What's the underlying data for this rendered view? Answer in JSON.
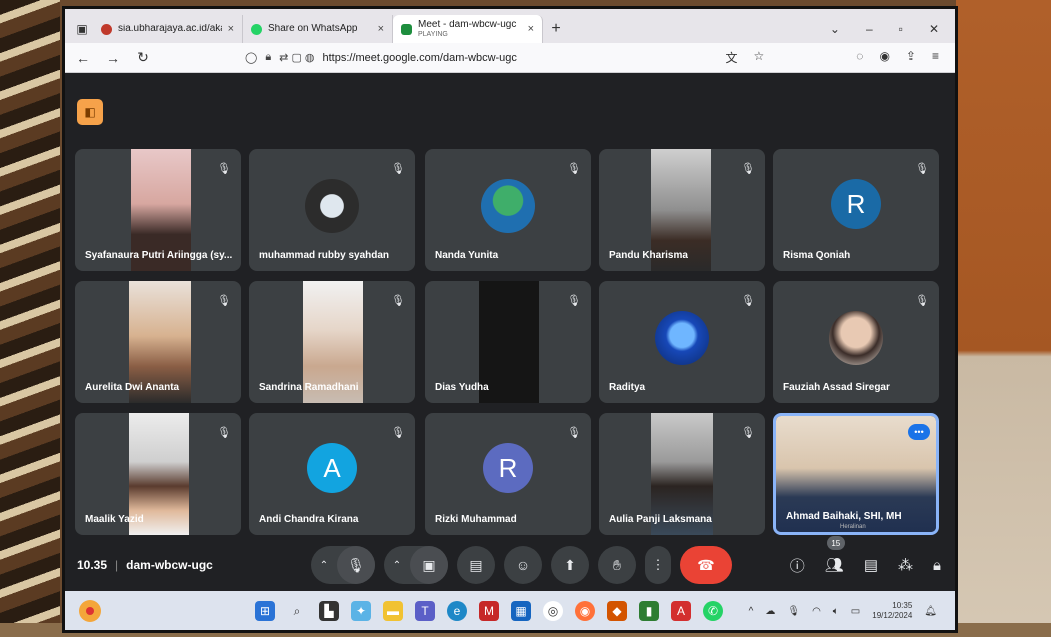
{
  "browser": {
    "tabs": [
      {
        "label": "sia.ubharajaya.ac.id/akademik/l",
        "sub": "",
        "favicon_color": "#c0392b",
        "active": false
      },
      {
        "label": "Share on WhatsApp",
        "sub": "",
        "favicon_color": "#25d366",
        "active": false
      },
      {
        "label": "Meet - dam-wbcw-ugc",
        "sub": "PLAYING",
        "favicon_color": "#1e8e3e",
        "active": true
      }
    ],
    "url": "https://meet.google.com/dam-wbcw-ugc"
  },
  "meeting": {
    "time": "10.35",
    "code": "dam-wbcw-ugc",
    "participant_count": "15",
    "participants": [
      {
        "name": "Syafanaura Putri Ariingga (sy..."
      },
      {
        "name": "muhammad rubby syahdan"
      },
      {
        "name": "Nanda Yunita"
      },
      {
        "name": "Pandu Kharisma"
      },
      {
        "name": "Risma Qoniah",
        "letter": "R",
        "avatar_color": "#1a6aa6"
      },
      {
        "name": "Aurelita Dwi Ananta"
      },
      {
        "name": "Sandrina Ramadhani"
      },
      {
        "name": "Dias Yudha"
      },
      {
        "name": "Raditya"
      },
      {
        "name": "Fauziah Assad Siregar"
      },
      {
        "name": "Maalik Yazid"
      },
      {
        "name": "Andi Chandra Kirana",
        "letter": "A",
        "avatar_color": "#12a4e0"
      },
      {
        "name": "Rizki Muhammad",
        "letter": "R",
        "avatar_color": "#5c6bc0"
      },
      {
        "name": "Aulia Panji Laksmana"
      },
      {
        "name": "Ahmad Baihaki, SHI, MH",
        "caption": "Heralinan"
      }
    ]
  },
  "taskbar": {
    "clock_time": "10:35",
    "clock_date": "19/12/2024"
  },
  "colors": {
    "leave": "#ea4335",
    "speaking_border": "#8ab4f8",
    "cam_off_badge": "#f6a24a"
  }
}
